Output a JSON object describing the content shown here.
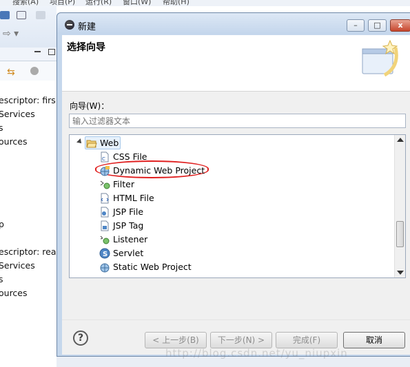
{
  "ide": {
    "menu": [
      "搜索(A)",
      "项目(P)",
      "运行(R)",
      "窗口(W)",
      "帮助(H)"
    ],
    "tree_lines": [
      "escriptor: firs",
      "Services",
      "s",
      "ources",
      "p",
      "escriptor: rea",
      "Services",
      "s",
      "ources"
    ]
  },
  "dialog": {
    "title": "新建",
    "window_buttons": [
      "–",
      "□",
      "x"
    ],
    "banner_title": "选择向导",
    "filter_label": "向导(W)：",
    "filter_placeholder": "输入过滤器文本",
    "tree": {
      "group_label": "Web",
      "items": [
        {
          "label": "CSS File",
          "icon": "css-file-icon"
        },
        {
          "label": "Dynamic Web Project",
          "icon": "web-project-icon"
        },
        {
          "label": "Filter",
          "icon": "filter-icon"
        },
        {
          "label": "HTML File",
          "icon": "html-file-icon"
        },
        {
          "label": "JSP File",
          "icon": "jsp-file-icon"
        },
        {
          "label": "JSP Tag",
          "icon": "jsp-tag-icon"
        },
        {
          "label": "Listener",
          "icon": "listener-icon"
        },
        {
          "label": "Servlet",
          "icon": "servlet-icon"
        },
        {
          "label": "Static Web Project",
          "icon": "static-web-project-icon"
        }
      ]
    },
    "buttons": {
      "help": "?",
      "back": "< 上一步(B)",
      "next": "下一步(N) >",
      "finish": "完成(F)",
      "cancel": "取消"
    }
  },
  "watermark": "http://blog.csdn.net/yu_niupxin"
}
